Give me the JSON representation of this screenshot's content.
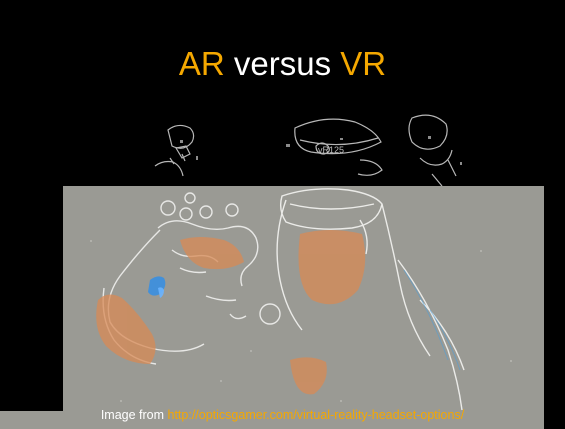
{
  "slide": {
    "title": {
      "part1": "AR",
      "part2": " versus ",
      "part3": "VR"
    },
    "caption": {
      "prefix": "Image from ",
      "link_text": "http://opticsgamer.com/virtual-reality-headset-options/"
    },
    "photo": {
      "icon": "vr-headset-users-photo"
    }
  },
  "colors": {
    "background": "#000000",
    "accent": "#f5a800",
    "text": "#ffffff",
    "photo_gray": "#9a9a94"
  }
}
